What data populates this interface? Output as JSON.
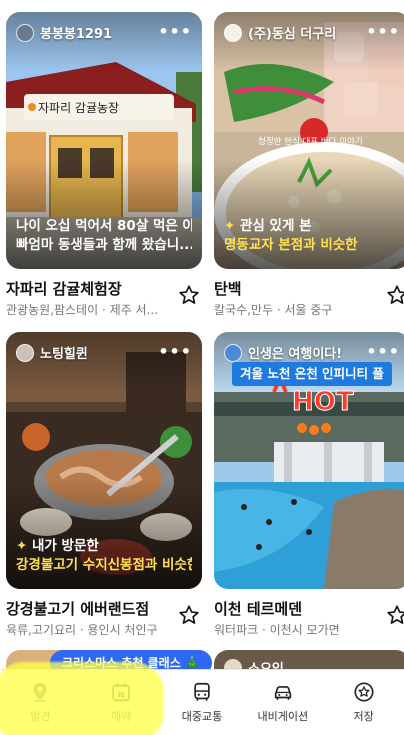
{
  "cards": [
    {
      "author": "봉봉봉1291",
      "caption_line1": "나이 오십 먹어서 80살 먹은 아",
      "caption_line2": "빠엄마 동생들과 함께 왔습니...",
      "title": "자파리 감귤체험장",
      "subtitle": "관광농원,팜스테이 · 제주 서...",
      "sign_text": "자파리  감귤농장"
    },
    {
      "author": "(주)동심 더구리",
      "caption_line1": "관심 있게 본",
      "caption_line2": "명동교자 본점과 비슷한",
      "title": "탄백",
      "subtitle": "칼국수,만두 · 서울 중구",
      "overlay_text": "청정한 한식 대표 바다 이야기"
    },
    {
      "author": "노팅힐퀸",
      "caption_line1": "내가 방문한",
      "caption_line2": "강경불고기 수지신봉점과 비슷한",
      "title": "강경불고기 에버랜드점",
      "subtitle": "육류,고기요리 · 용인시 처인구"
    },
    {
      "author": "인생은 여행이다!",
      "banner": "겨울 노천 온천 인피니티 풀",
      "hot": "HOT",
      "title": "이천 테르메덴",
      "subtitle": "워터파크 · 이천시 모가면"
    }
  ],
  "peek_author": "소요임",
  "christmas_pill": "크리스마스 추천 클래스 🎄",
  "tabs": [
    {
      "label": "발견",
      "icon": "location-pin-icon"
    },
    {
      "label": "예약",
      "icon": "calendar-n-icon"
    },
    {
      "label": "대중교통",
      "icon": "bus-icon"
    },
    {
      "label": "내비게이션",
      "icon": "car-icon"
    },
    {
      "label": "저장",
      "icon": "star-circle-icon"
    }
  ],
  "colors": {
    "accent": "#2f68f5",
    "highlight": "#ffff4d",
    "caption_yellow": "#ffe14d"
  }
}
